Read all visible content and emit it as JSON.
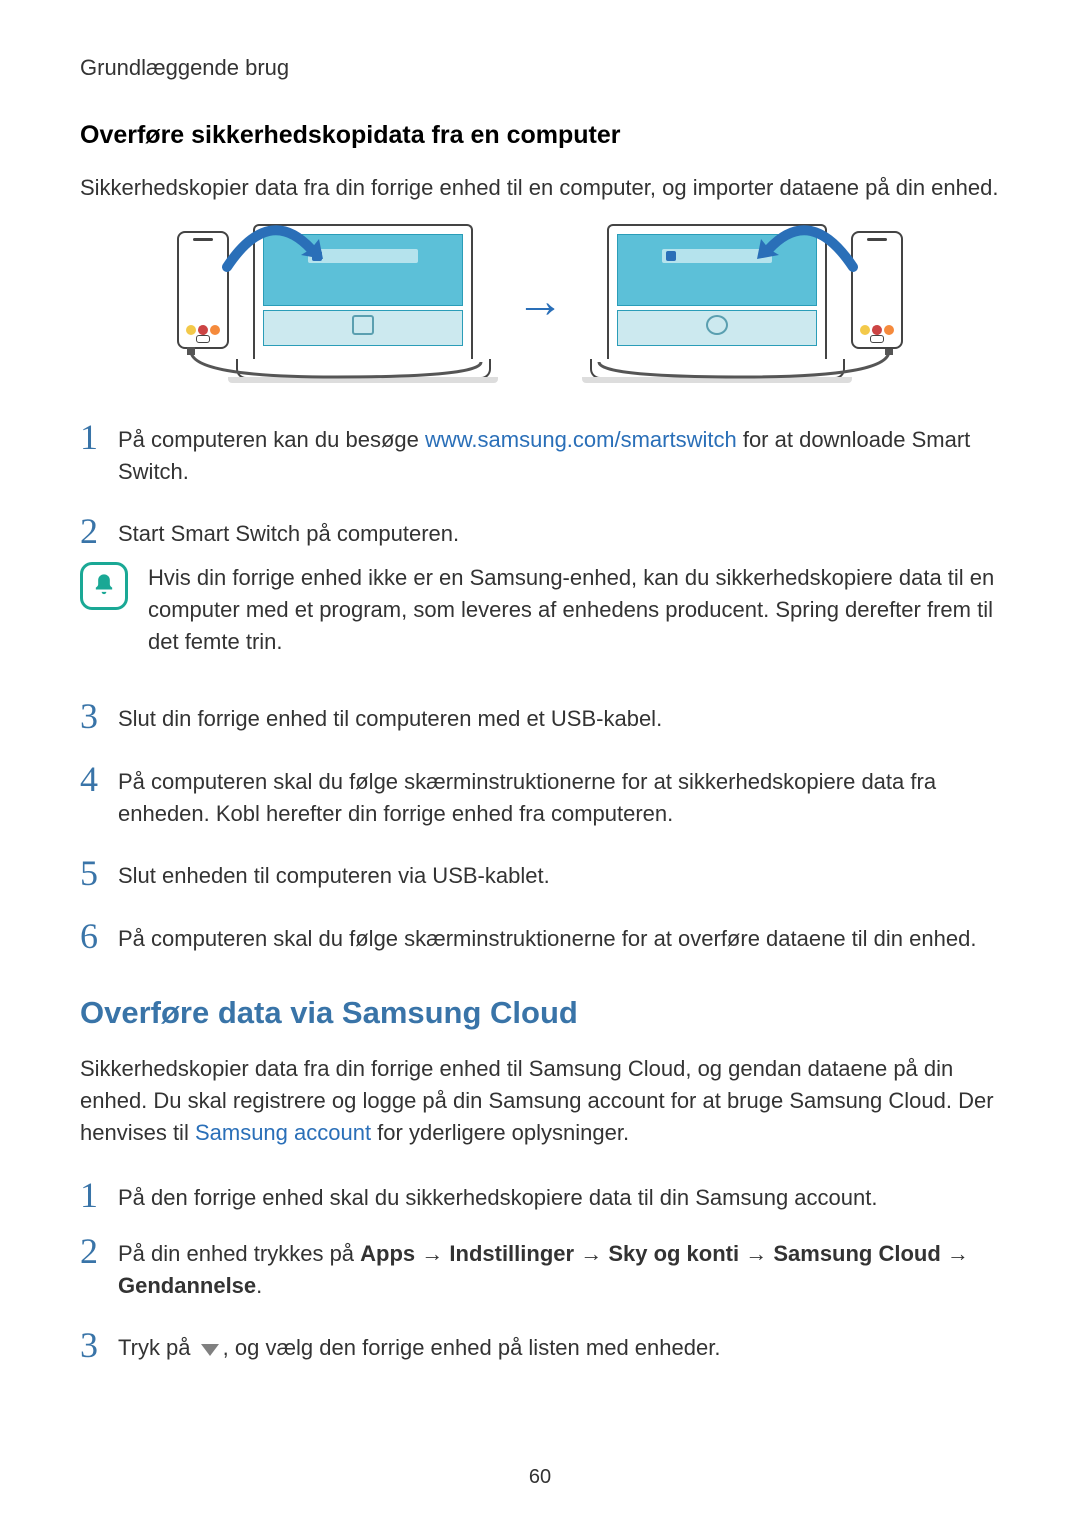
{
  "header": "Grundlæggende brug",
  "section1_heading": "Overføre sikkerhedskopidata fra en computer",
  "intro1": "Sikkerhedskopier data fra din forrige enhed til en computer, og importer dataene på din enhed.",
  "steps_a": {
    "s1": {
      "num": "1",
      "pre": "På computeren kan du besøge ",
      "link": "www.samsung.com/smartswitch",
      "post": " for at downloade Smart Switch."
    },
    "s2": {
      "num": "2",
      "text": "Start Smart Switch på computeren."
    },
    "note": "Hvis din forrige enhed ikke er en Samsung-enhed, kan du sikkerhedskopiere data til en computer med et program, som leveres af enhedens producent. Spring derefter frem til det femte trin.",
    "s3": {
      "num": "3",
      "text": "Slut din forrige enhed til computeren med et USB-kabel."
    },
    "s4": {
      "num": "4",
      "text": "På computeren skal du følge skærminstruktionerne for at sikkerhedskopiere data fra enheden. Kobl herefter din forrige enhed fra computeren."
    },
    "s5": {
      "num": "5",
      "text": "Slut enheden til computeren via USB-kablet."
    },
    "s6": {
      "num": "6",
      "text": "På computeren skal du følge skærminstruktionerne for at overføre dataene til din enhed."
    }
  },
  "section2_title": "Overføre data via Samsung Cloud",
  "intro2_pre": "Sikkerhedskopier data fra din forrige enhed til Samsung Cloud, og gendan dataene på din enhed. Du skal registrere og logge på din Samsung account for at bruge Samsung Cloud. Der henvises til ",
  "intro2_link": "Samsung account",
  "intro2_post": " for yderligere oplysninger.",
  "steps_b": {
    "s1": {
      "num": "1",
      "text": "På den forrige enhed skal du sikkerhedskopiere data til din Samsung account."
    },
    "s2": {
      "num": "2",
      "pre": "På din enhed trykkes på ",
      "p1": "Apps",
      "p2": "Indstillinger",
      "p3": "Sky og konti",
      "p4": "Samsung Cloud",
      "p5": "Gendannelse",
      "arrow": " → ",
      "end": "."
    },
    "s3": {
      "num": "3",
      "pre": "Tryk på ",
      "post": ", og vælg den forrige enhed på listen med enheder."
    }
  },
  "page_number": "60"
}
